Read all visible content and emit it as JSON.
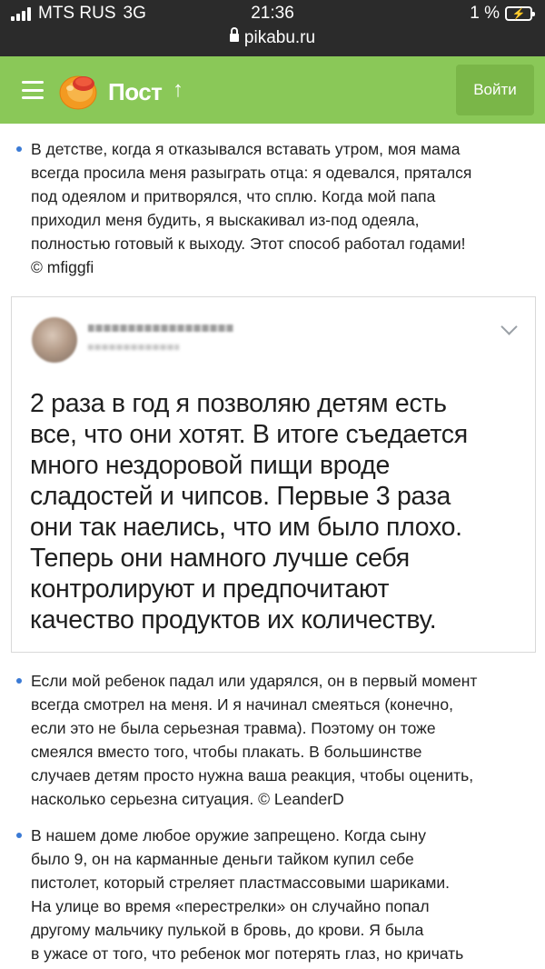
{
  "status_bar": {
    "carrier": "MTS RUS",
    "network": "3G",
    "time": "21:36",
    "url": "pikabu.ru",
    "battery_percent": "1 %"
  },
  "header": {
    "title": "Пост",
    "login_label": "Войти",
    "accent_color": "#8ac858"
  },
  "post": {
    "item1_lines": [
      "В детстве, когда я отказывался вставать утром, моя мама",
      "всегда просила меня разыграть отца: я одевался, прятался",
      "под одеялом и притворялся, что сплю. Когда мой папа",
      "приходил меня будить, я выскакивал из-под одеяла,",
      "полностью готовый к выходу. Этот способ работал годами!",
      "© mfiggfi"
    ],
    "tweet": {
      "text_lines": [
        "2 раза в год я позволяю детям есть",
        "все, что они хотят. В итоге съедается",
        "много нездоровой пищи вроде",
        "сладостей и чипсов. Первые 3 раза",
        "они так наелись, что им было плохо.",
        "Теперь они намного лучше себя",
        "контролируют и предпочитают",
        "качество продуктов их количеству."
      ]
    },
    "item2_lines": [
      "Если мой ребенок падал или ударялся, он в первый момент",
      "всегда смотрел на меня. И я начинал смеяться (конечно,",
      "если это не была серьезная травма). Поэтому он тоже",
      "смеялся вместо того, чтобы плакать. В большинстве",
      "случаев детям просто нужна ваша реакция, чтобы оценить,",
      "насколько серьезна ситуация. © LeanderD"
    ],
    "item3_lines": [
      "В нашем доме любое оружие запрещено. Когда сыну",
      "было 9, он на карманные деньги тайком купил себе",
      "пистолет, который стреляет пластмассовыми шариками.",
      "На улице во время «перестрелки» он случайно попал",
      "другому мальчику пулькой в бровь, до крови. Я была",
      "в ужасе от того, что ребенок мог потерять глаз, но кричать"
    ]
  }
}
